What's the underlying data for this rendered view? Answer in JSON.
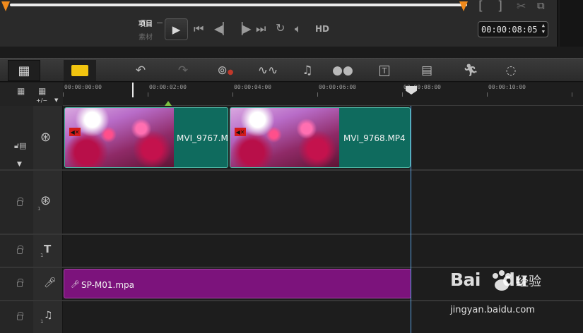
{
  "player": {
    "mode_project": "项目",
    "mode_clip": "素材",
    "timecode": "00:00:08:05",
    "hd_label": "HD",
    "icons": {
      "play": "play-icon",
      "home": "go-start-icon",
      "prev_frame": "prev-frame-icon",
      "next_frame": "next-frame-icon",
      "end": "go-end-icon",
      "repeat": "repeat-icon",
      "volume": "volume-icon",
      "mark_in": "mark-in-icon",
      "mark_out": "mark-out-icon",
      "cut": "scissors-icon",
      "copy": "copy-icon"
    },
    "scrub_color": "#f08a1c"
  },
  "toolbar": {
    "items": [
      {
        "name": "storyboard-view-button",
        "glyph": "▦"
      },
      {
        "name": "timeline-view-button",
        "glyph": "☰"
      },
      {
        "name": "undo-button",
        "glyph": "↶"
      },
      {
        "name": "redo-button",
        "glyph": "↷"
      },
      {
        "name": "record-capture-button",
        "glyph": "◉"
      },
      {
        "name": "sound-mixer-button",
        "glyph": "♒"
      },
      {
        "name": "auto-music-button",
        "glyph": "♫"
      },
      {
        "name": "motion-tracking-button",
        "glyph": "●"
      },
      {
        "name": "subtitle-editor-button",
        "glyph": "T"
      },
      {
        "name": "multi-trim-button",
        "glyph": "▤"
      },
      {
        "name": "speed-button",
        "glyph": "⚡"
      },
      {
        "name": "path-button",
        "glyph": "◌"
      }
    ]
  },
  "ruler": {
    "labels": [
      "00:00:00:00",
      "00:00:02:00",
      "00:00:04:00",
      "00:00:06:00",
      "00:00:08:00",
      "00:00:10:00"
    ],
    "add_remove": "+/−"
  },
  "tracks": {
    "video_clips": [
      {
        "name": "MVI_9767.M",
        "muted": true
      },
      {
        "name": "MVI_9768.MP4",
        "muted": true
      }
    ],
    "audio_clip": {
      "name": "SP-M01.mpa"
    },
    "overlay_index": "1",
    "title_index": "1",
    "music_index": "1"
  },
  "watermark": {
    "brand": "Bai",
    "brand2": "du",
    "cn": "经验",
    "url": "jingyan.baidu.com"
  }
}
